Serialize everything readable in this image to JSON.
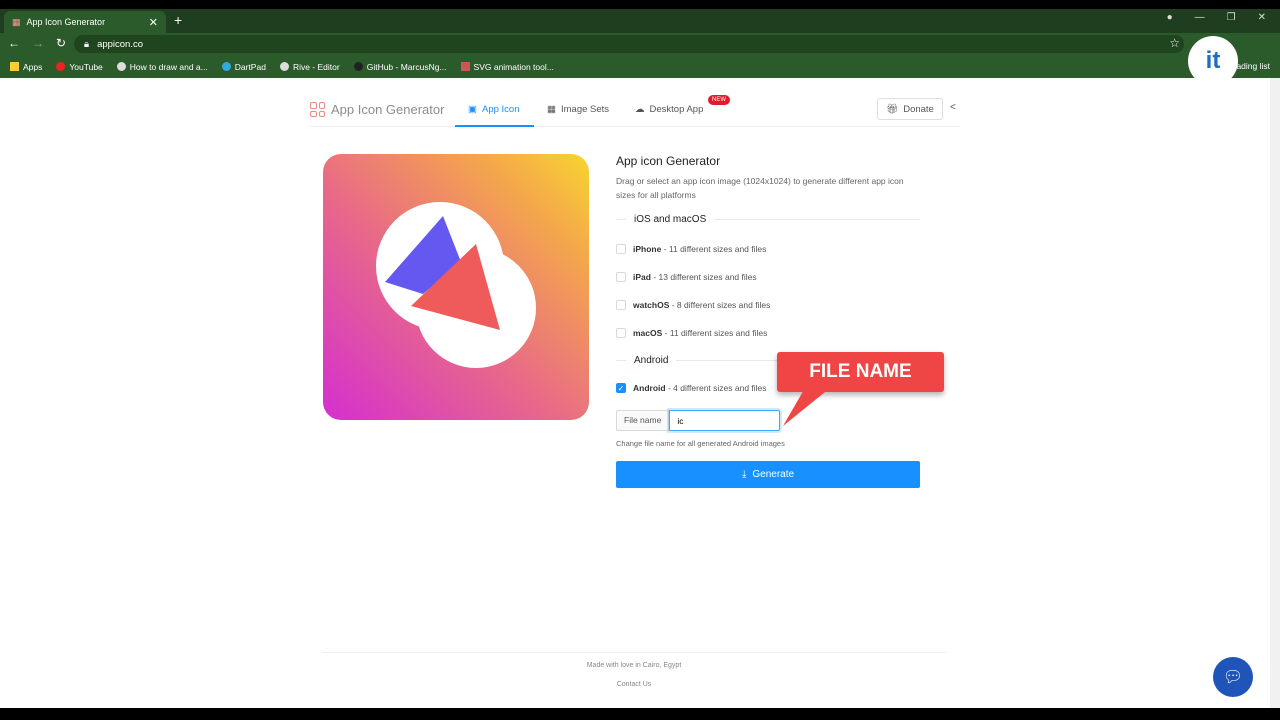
{
  "browser": {
    "tab_title": "App Icon Generator",
    "url": "appicon.co",
    "reading_list": "Reading list",
    "bookmarks": [
      "Apps",
      "YouTube",
      "How to draw and a...",
      "DartPad",
      "Rive - Editor",
      "GitHub - MarcusNg...",
      "SVG animation tool..."
    ]
  },
  "header": {
    "brand": "App Icon Generator",
    "tabs": [
      "App Icon",
      "Image Sets",
      "Desktop App"
    ],
    "new_badge": "NEW",
    "donate": "Donate"
  },
  "main": {
    "title": "App icon Generator",
    "description": "Drag or select an app icon image (1024x1024) to generate different app icon sizes for all platforms",
    "ios_section": "iOS and macOS",
    "ios_options": [
      {
        "name": "iPhone",
        "detail": " - 11 different sizes and files",
        "checked": false
      },
      {
        "name": "iPad",
        "detail": " - 13 different sizes and files",
        "checked": false
      },
      {
        "name": "watchOS",
        "detail": " - 8 different sizes and files",
        "checked": false
      },
      {
        "name": "macOS",
        "detail": " - 11 different sizes and files",
        "checked": false
      }
    ],
    "android_section": "Android",
    "android_option": {
      "name": "Android",
      "detail": " - 4 different sizes and files",
      "checked": true
    },
    "file_name_label": "File name",
    "file_name_value": "ic",
    "hint": "Change file name for all generated Android images",
    "generate": "Generate"
  },
  "annotation": "FILE NAME",
  "footer": {
    "made_with": "Made with love in Cairo, Egypt",
    "contact": "Contact Us"
  }
}
